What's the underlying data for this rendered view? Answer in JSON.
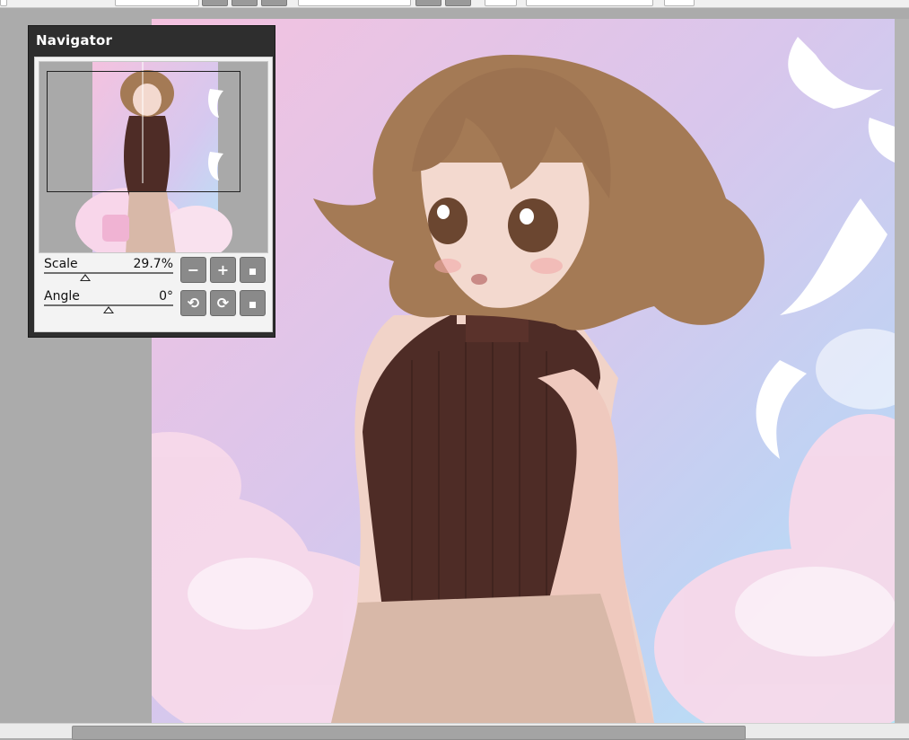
{
  "navigator": {
    "title": "Navigator",
    "scale": {
      "label": "Scale",
      "value": "29.7%",
      "slider_fraction": 0.32
    },
    "angle": {
      "label": "Angle",
      "value": "0°",
      "slider_fraction": 0.5
    },
    "buttons": {
      "zoom_out_glyph": "−",
      "zoom_in_glyph": "+",
      "rotate_left_glyph": "⟲",
      "rotate_right_glyph": "⟳"
    },
    "icons": [
      "minus-icon",
      "plus-icon",
      "square-icon",
      "rotate-left-icon",
      "rotate-right-icon",
      "square-icon"
    ]
  },
  "canvas": {
    "artwork": "anime-girl-illustration",
    "colors": {
      "sky_pink": "#f4c2df",
      "sky_blue": "#b3e6f8",
      "hair": "#a47a55",
      "sweater": "#4e2c26",
      "skin": "#f1d3c8"
    }
  },
  "workspace": {
    "background": "#ababab"
  }
}
